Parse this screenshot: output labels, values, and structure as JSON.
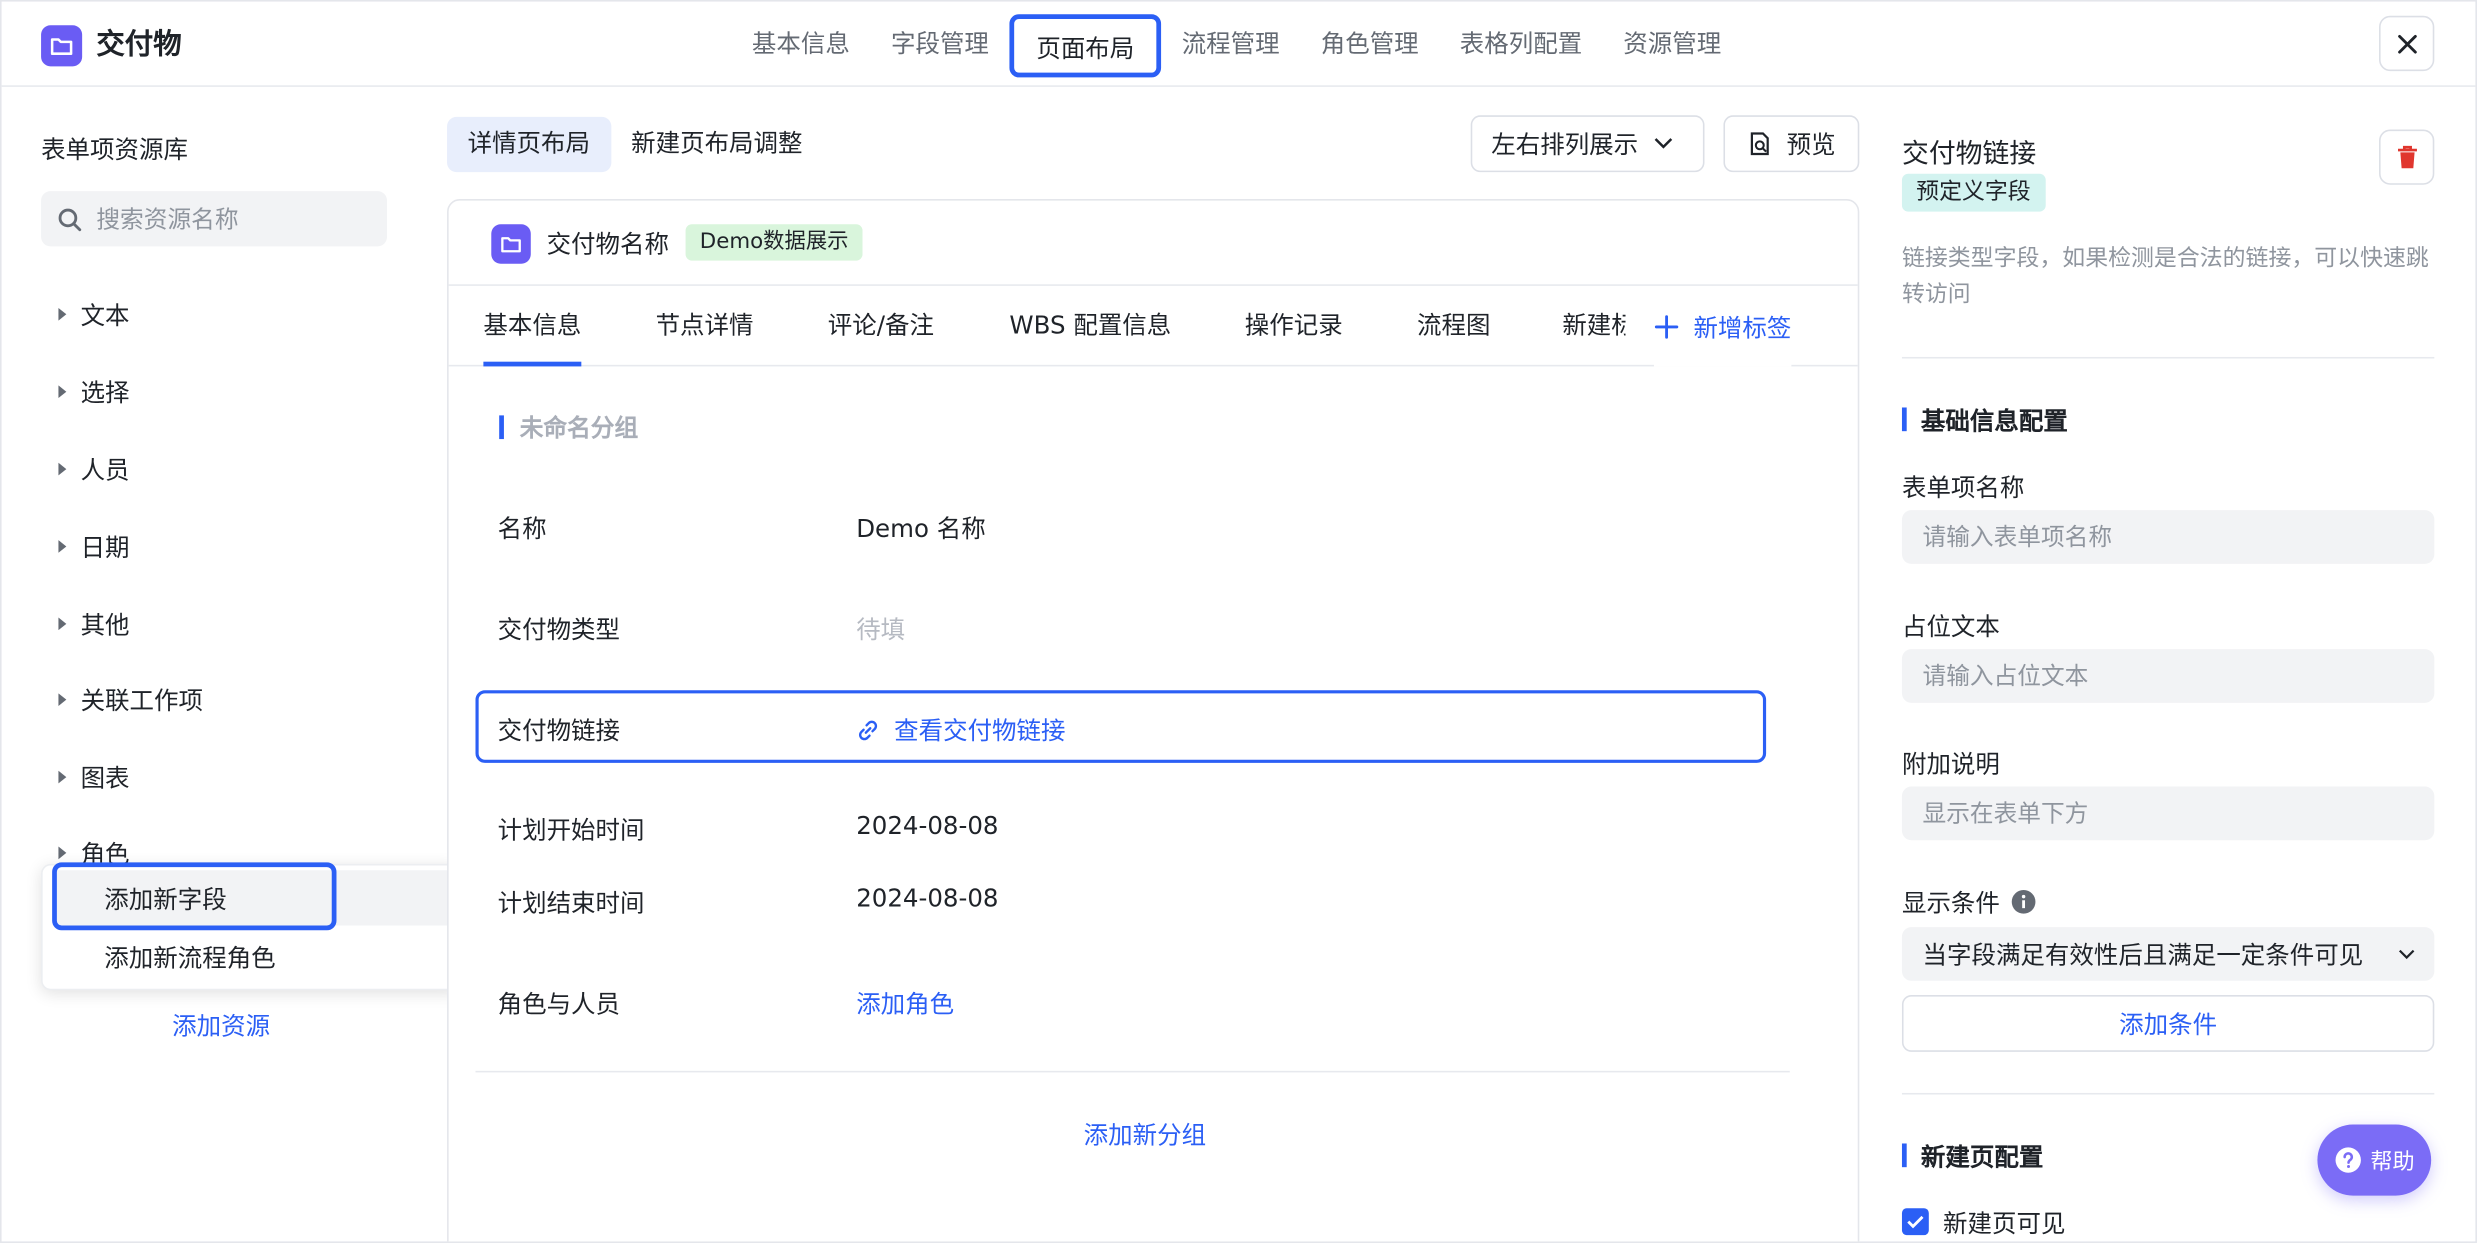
{
  "app": {
    "title": "交付物"
  },
  "top_tabs": [
    {
      "label": "基本信息"
    },
    {
      "label": "字段管理"
    },
    {
      "label": "页面布局",
      "active": true
    },
    {
      "label": "流程管理"
    },
    {
      "label": "角色管理"
    },
    {
      "label": "表格列配置"
    },
    {
      "label": "资源管理"
    }
  ],
  "left": {
    "title": "表单项资源库",
    "search_placeholder": "搜索资源名称",
    "categories": [
      "文本",
      "选择",
      "人员",
      "日期",
      "其他",
      "关联工作项",
      "图表",
      "角色"
    ],
    "dropdown": [
      "添加新字段",
      "添加新流程角色"
    ],
    "add_resource": "添加资源"
  },
  "center": {
    "layout_tabs": [
      "详情页布局",
      "新建页布局调整"
    ],
    "sort_label": "左右排列展示",
    "preview_label": "预览",
    "card_title": "交付物名称",
    "demo_badge": "Demo数据展示",
    "detail_tabs": [
      "基本信息",
      "节点详情",
      "评论/备注",
      "WBS 配置信息",
      "操作记录",
      "流程图",
      "新建标"
    ],
    "add_tab_label": "新增标签",
    "group_title": "未命名分组",
    "fields": [
      {
        "label": "名称",
        "value": "Demo 名称"
      },
      {
        "label": "交付物类型",
        "value": "待填"
      },
      {
        "label": "交付物链接",
        "value": "查看交付物链接"
      },
      {
        "label": "计划开始时间",
        "value": "2024-08-08"
      },
      {
        "label": "计划结束时间",
        "value": "2024-08-08"
      },
      {
        "label": "角色与人员",
        "value": "添加角色"
      }
    ],
    "add_group": "添加新分组"
  },
  "right": {
    "title": "交付物链接",
    "badge": "预定义字段",
    "description": "链接类型字段，如果检测是合法的链接，可以快速跳转访问",
    "section_basic": "基础信息配置",
    "name_label": "表单项名称",
    "name_placeholder": "请输入表单项名称",
    "placeholder_label": "占位文本",
    "placeholder_placeholder": "请输入占位文本",
    "note_label": "附加说明",
    "note_placeholder": "显示在表单下方",
    "condition_label": "显示条件",
    "condition_value": "当字段满足有效性后且满足一定条件可见",
    "add_condition": "添加条件",
    "section_new": "新建页配置",
    "new_visible_label": "新建页可见",
    "new_visible_checked": true
  },
  "help_label": "帮助",
  "colors": {
    "accent": "#2b5ff5",
    "brand": "#6a5cf4",
    "help": "#7b6cf6",
    "delete": "#e0362e"
  }
}
